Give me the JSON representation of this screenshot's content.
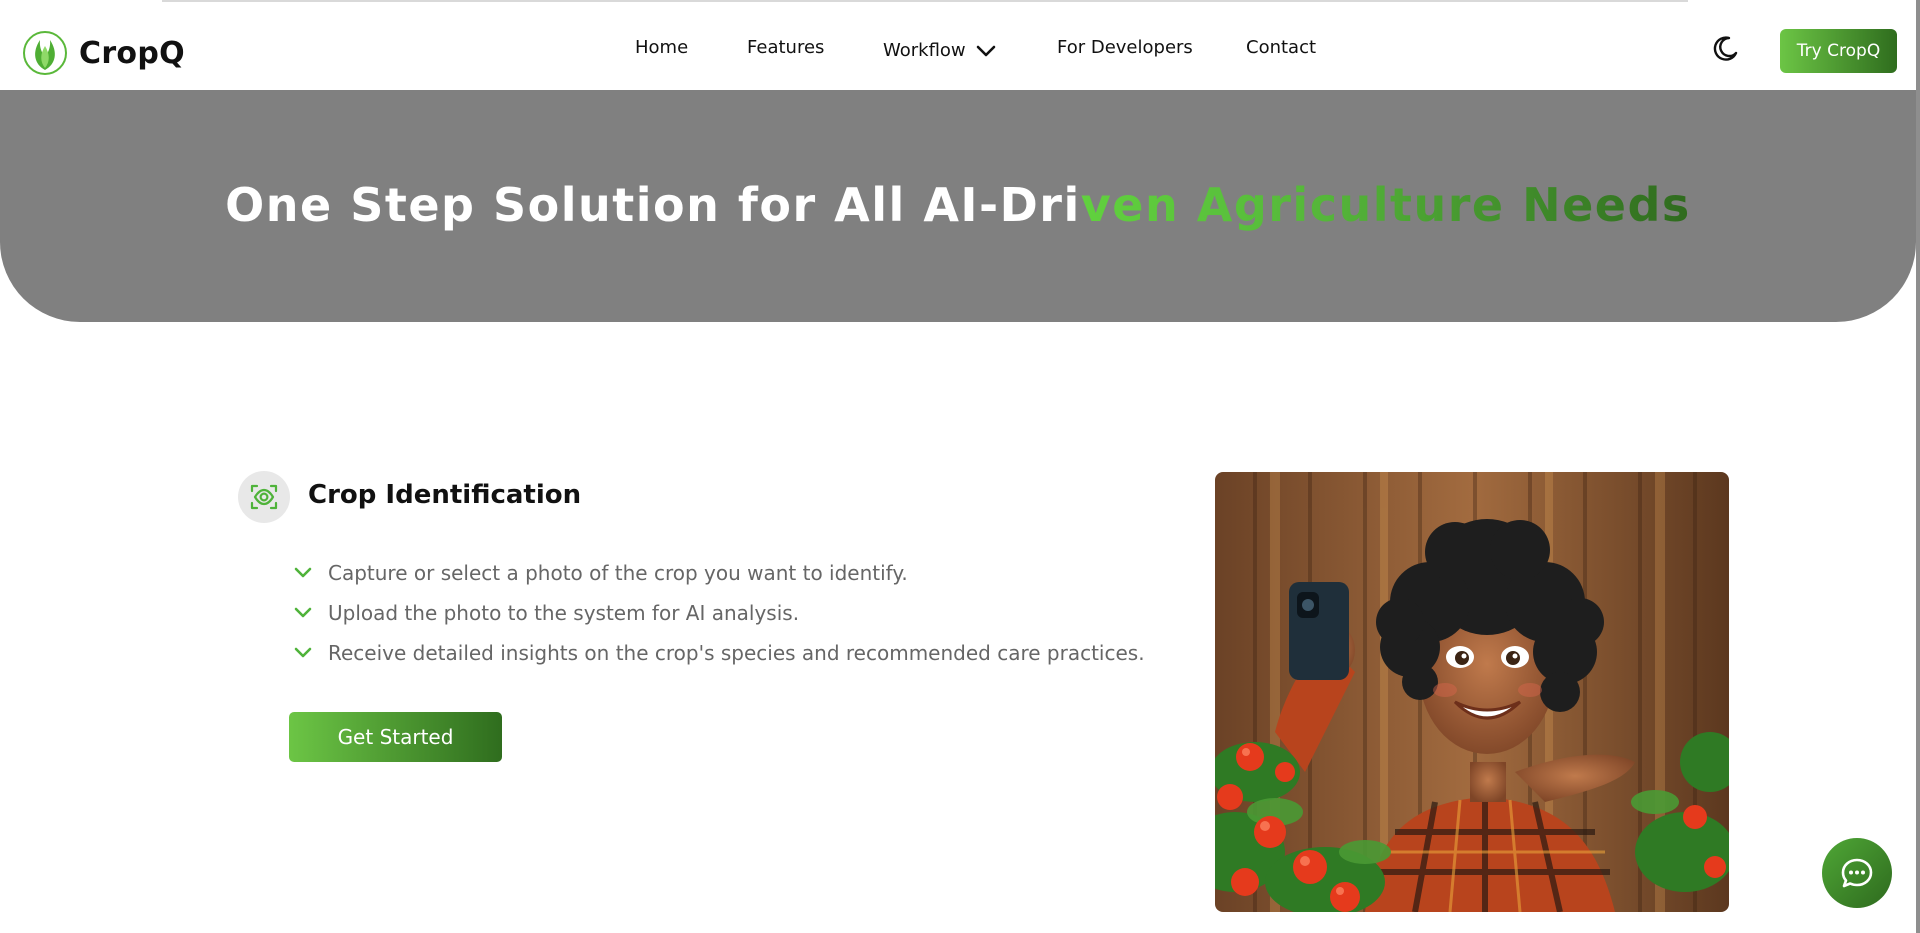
{
  "brand": {
    "name": "CropQ"
  },
  "nav": {
    "items": [
      {
        "label": "Home"
      },
      {
        "label": "Features"
      },
      {
        "label": "Workflow"
      },
      {
        "label": "For Developers"
      },
      {
        "label": "Contact"
      }
    ],
    "cta_label": "Try CropQ"
  },
  "hero": {
    "title_plain": "One Step Solution for All AI-Dri",
    "title_highlight": "ven Agriculture Needs"
  },
  "feature": {
    "title": "Crop Identification",
    "steps": [
      "Capture or select a photo of the crop you want to identify.",
      "Upload the photo to the system for AI analysis.",
      "Receive detailed insights on the crop's species and recommended care practices."
    ],
    "button_label": "Get Started"
  },
  "icons": {
    "logo": "leaf-flame-icon",
    "workflow_dropdown": "chevron-down-icon",
    "theme": "moon-icon",
    "feature": "eye-scan-icon",
    "check": "check-icon",
    "chat": "chat-bubble-icon"
  },
  "colors": {
    "accent_green": "#6cc545",
    "dark_green": "#2f6d1e",
    "hero_bg": "#808080",
    "hero_title_white": "#ffffff",
    "body_text_grey": "#666666"
  }
}
